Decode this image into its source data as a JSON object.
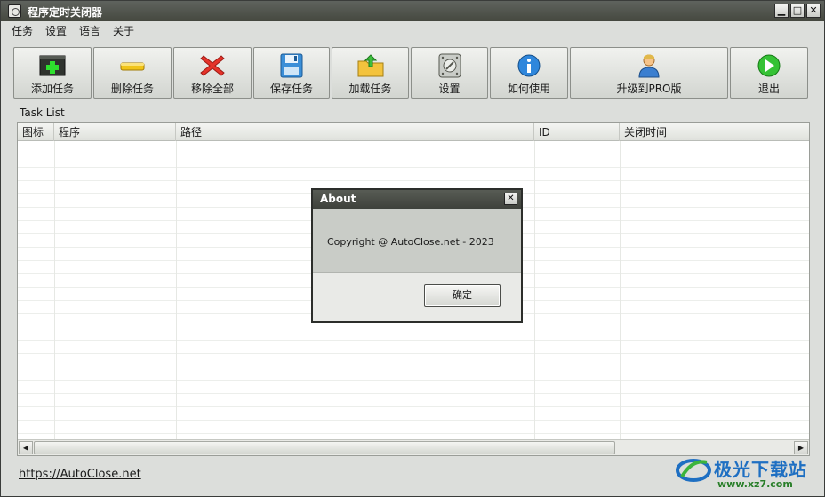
{
  "window": {
    "title": "程序定时关闭器",
    "controls": {
      "minimize": "▁",
      "maximize": "□",
      "close": "✕"
    }
  },
  "menu": [
    "任务",
    "设置",
    "语言",
    "关于"
  ],
  "toolbar": [
    {
      "label": "添加任务",
      "icon": "add-task-icon"
    },
    {
      "label": "删除任务",
      "icon": "delete-task-icon"
    },
    {
      "label": "移除全部",
      "icon": "remove-all-icon"
    },
    {
      "label": "保存任务",
      "icon": "save-icon"
    },
    {
      "label": "加载任务",
      "icon": "load-folder-icon"
    },
    {
      "label": "设置",
      "icon": "settings-icon"
    },
    {
      "label": "如何使用",
      "icon": "info-icon"
    },
    {
      "label": "升级到PRO版",
      "icon": "user-upgrade-icon"
    },
    {
      "label": "退出",
      "icon": "exit-icon"
    }
  ],
  "task_list": {
    "label": "Task List",
    "columns": [
      "图标",
      "程序",
      "路径",
      "ID",
      "关闭时间"
    ]
  },
  "footer": {
    "link": "https://AutoClose.net"
  },
  "dialog": {
    "title": "About",
    "message": "Copyright @ AutoClose.net - 2023",
    "ok_label": "确定",
    "close_glyph": "✕"
  },
  "watermark": {
    "title": "极光下载站",
    "url": "www.xz7.com"
  },
  "colors": {
    "titlebar": "#45483f",
    "window_bg": "#dcdedb",
    "watermark_blue": "#1e6fc2",
    "watermark_green": "#2a7f2a"
  }
}
